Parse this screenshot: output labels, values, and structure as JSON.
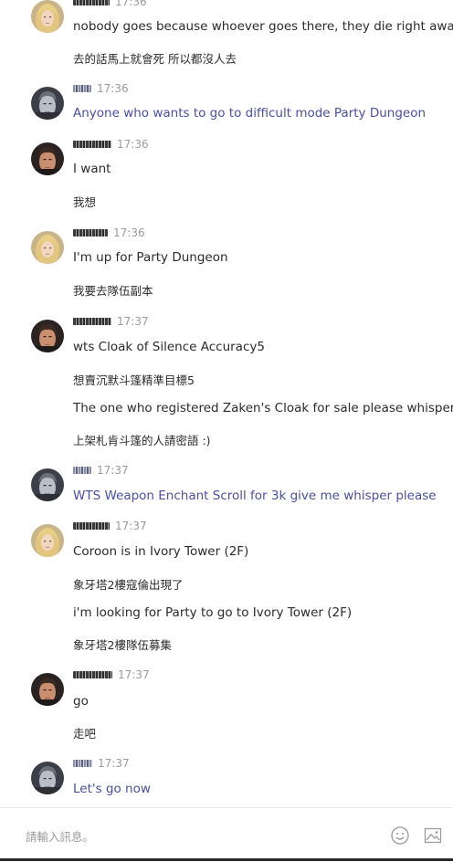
{
  "messages": [
    {
      "avatar": "blonde-elf-avatar",
      "time": "17:36",
      "lines": [
        {
          "text": "nobody goes because whoever goes there, they die right away"
        },
        {
          "text": "去的話馬上就會死 所以都沒人去",
          "cjk": true
        }
      ]
    },
    {
      "avatar": "dark-elf-avatar",
      "time": "17:36",
      "lines": [
        {
          "text": "Anyone who wants to go to difficult mode Party Dungeon",
          "party": true
        }
      ]
    },
    {
      "avatar": "human-male-avatar",
      "time": "17:36",
      "lines": [
        {
          "text": "I want"
        },
        {
          "text": "我想",
          "cjk": true
        }
      ]
    },
    {
      "avatar": "blonde-elf-avatar",
      "time": "17:36",
      "lines": [
        {
          "text": "I'm up for Party Dungeon"
        },
        {
          "text": "我要去隊伍副本",
          "cjk": true
        }
      ]
    },
    {
      "avatar": "human-male-avatar",
      "time": "17:37",
      "lines": [
        {
          "text": "wts Cloak of Silence Accuracy5"
        },
        {
          "text": "想賣沉默斗篷精準目標5",
          "cjk": true
        },
        {
          "text": "The one who registered Zaken's Cloak for sale please whisper :)"
        },
        {
          "text": "上架札肯斗篷的人請密語 :)",
          "cjk": true
        }
      ]
    },
    {
      "avatar": "dark-elf-avatar",
      "time": "17:37",
      "lines": [
        {
          "text": "WTS Weapon Enchant Scroll for 3k give me whisper please",
          "party": true
        }
      ]
    },
    {
      "avatar": "blonde-elf-avatar",
      "time": "17:37",
      "lines": [
        {
          "text": "Coroon is in Ivory Tower (2F)"
        },
        {
          "text": "象牙塔2樓寇倫出現了",
          "cjk": true
        },
        {
          "text": "i'm looking for Party to go to Ivory Tower (2F)"
        },
        {
          "text": "象牙塔2樓隊伍募集",
          "cjk": true
        }
      ]
    },
    {
      "avatar": "human-male-avatar",
      "time": "17:37",
      "lines": [
        {
          "text": "go"
        },
        {
          "text": "走吧",
          "cjk": true
        }
      ]
    },
    {
      "avatar": "dark-elf-avatar",
      "time": "17:37",
      "lines": [
        {
          "text": "Let's go now",
          "party": true
        }
      ]
    }
  ],
  "input": {
    "placeholder": "請輸入訊息。"
  },
  "tools": {
    "emoji": "smiley-face-icon",
    "image": "image-upload-icon"
  },
  "colors": {
    "party_text": "#4a4fa0",
    "normal_text": "#2b2b2b",
    "time": "#9a9a9a"
  }
}
